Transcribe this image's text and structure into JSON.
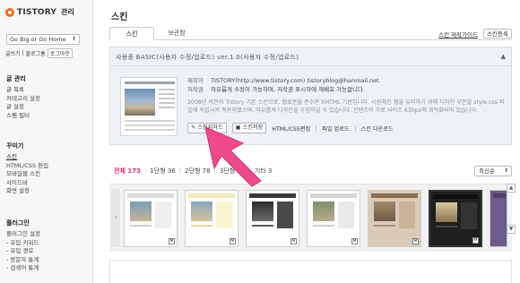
{
  "sidebar": {
    "logo_text": "TISTORY",
    "logo_sub": "관리",
    "blog_select": "Go Big or Go Home",
    "quick_links": [
      "글쓰기",
      "블로그홈",
      "로그아웃"
    ],
    "sections": [
      {
        "title": "글 관리",
        "items": [
          "글 목록",
          "카테고리 설정",
          "글 설정",
          "스팸 필터"
        ]
      },
      {
        "title": "꾸미기",
        "items": [
          "스킨",
          "HTML/CSS 편집",
          "모바일웹 스킨",
          "사이드바",
          "화면 설정"
        ]
      },
      {
        "title": "플러그인",
        "items": [
          "플러그인 설정",
          "- 유입 키워드",
          "- 유입 경로",
          "- 방문자 통계",
          "- 검색어 통계"
        ]
      }
    ],
    "active_item": "스킨"
  },
  "main": {
    "title": "스킨",
    "tabs": [
      {
        "label": "스킨"
      },
      {
        "label": "보관함"
      }
    ],
    "tab_links": {
      "manual": "스킨 제작가이드",
      "register": "스킨등록"
    },
    "panel": {
      "title": "사용중  BASIC(사용자 수정/업로드) ver.1.0(사용자 수정/업로드)",
      "author_key": "제작자",
      "author_val": "TISTORY(http://www.tistory.com) tistoryblog@hanmail.net",
      "copyright_key": "저작권",
      "copyright_val": "자유롭게 수정이 가능하며, 저작권 표시하에 재배포 가능합니다.",
      "description": "2008년 버전의 Tistory 기본 스킨으로, 웹표준을 준수한 XHTML 기반입니다. 시원해진 웹을 유지하기 위해 디자인 부분을 style.css 파일에 독립시켜 적용하였으며, 자유롭게 디자인을 수정하실 수 있습니다. 컨텐츠의 가로 사이즈 630px에 최적화되어 있습니다.",
      "actions": {
        "wizard": "스킨위자드",
        "save": "스킨저장",
        "edit": "HTML/CSS편집",
        "upload": "파일 업로드",
        "download": "스킨 다운로드"
      }
    },
    "filters": [
      {
        "label": "전체 173",
        "active": true
      },
      {
        "label": "1단형 36",
        "active": false
      },
      {
        "label": "2단형 78",
        "active": false
      },
      {
        "label": "3단형 55",
        "active": false
      },
      {
        "label": "기타 3",
        "active": false
      }
    ],
    "sort": "최신순"
  },
  "colors": {
    "accent": "#e0307a",
    "pointer": "#f04a8c"
  }
}
